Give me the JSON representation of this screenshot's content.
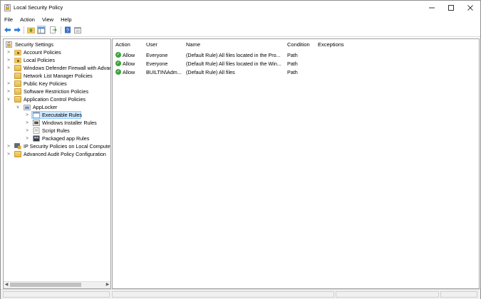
{
  "window": {
    "title": "Local Security Policy"
  },
  "menu": [
    "File",
    "Action",
    "View",
    "Help"
  ],
  "toolbar": {
    "buttons": [
      "back-arrow-icon",
      "forward-arrow-icon",
      "up-folder-icon",
      "show-hide-tree-icon",
      "export-list-icon",
      "help-icon",
      "console-icon"
    ]
  },
  "tree": {
    "root": "Security Settings",
    "items": [
      {
        "label": "Account Policies",
        "level": 1,
        "expander": ">"
      },
      {
        "label": "Local Policies",
        "level": 1,
        "expander": ">"
      },
      {
        "label": "Windows Defender Firewall with Advanced Security",
        "level": 1,
        "expander": ">"
      },
      {
        "label": "Network List Manager Policies",
        "level": 1,
        "expander": ""
      },
      {
        "label": "Public Key Policies",
        "level": 1,
        "expander": ">"
      },
      {
        "label": "Software Restriction Policies",
        "level": 1,
        "expander": ">"
      },
      {
        "label": "Application Control Policies",
        "level": 1,
        "expander": "v"
      },
      {
        "label": "AppLocker",
        "level": 2,
        "expander": "v"
      },
      {
        "label": "Executable Rules",
        "level": 3,
        "expander": ">",
        "selected": true
      },
      {
        "label": "Windows Installer Rules",
        "level": 3,
        "expander": ">"
      },
      {
        "label": "Script Rules",
        "level": 3,
        "expander": ">"
      },
      {
        "label": "Packaged app Rules",
        "level": 3,
        "expander": ">"
      },
      {
        "label": "IP Security Policies on Local Computer",
        "level": 1,
        "expander": ">"
      },
      {
        "label": "Advanced Audit Policy Configuration",
        "level": 1,
        "expander": ">"
      }
    ]
  },
  "list": {
    "columns": [
      "Action",
      "User",
      "Name",
      "Condition",
      "Exceptions"
    ],
    "rows": [
      {
        "action": "Allow",
        "user": "Everyone",
        "name": "(Default Rule) All files located in the Pro...",
        "condition": "Path",
        "exceptions": ""
      },
      {
        "action": "Allow",
        "user": "Everyone",
        "name": "(Default Rule) All files located in the Win...",
        "condition": "Path",
        "exceptions": ""
      },
      {
        "action": "Allow",
        "user": "BUILTIN\\Adm...",
        "name": "(Default Rule) All files",
        "condition": "Path",
        "exceptions": ""
      }
    ]
  },
  "colors": {
    "selection": "#cce8ff",
    "allow": "#3aa43a",
    "folder": "#f0c75e"
  }
}
